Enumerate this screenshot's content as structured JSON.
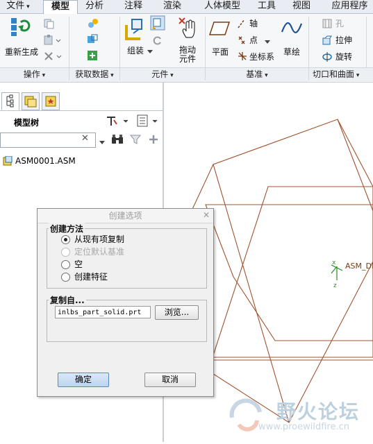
{
  "menu": {
    "tabs": [
      "文件",
      "模型",
      "分析",
      "注释",
      "渲染",
      "人体模型",
      "工具",
      "视图",
      "应用程序"
    ]
  },
  "ribbon": {
    "regenerate": "重新生成",
    "assemble": "组装",
    "drag_components": [
      "拖动",
      "元件"
    ],
    "plane": "平面",
    "axis": "轴",
    "point": "点",
    "csys": "坐标系",
    "sketch": "草绘",
    "hole": "孔",
    "extrude": "拉伸",
    "revolve": "旋转",
    "groups": [
      "操作",
      "获取数据",
      "元件",
      "基准",
      "切口和曲面"
    ]
  },
  "model_tree": {
    "title": "模型树",
    "search_value": "",
    "root_item": "ASM0001.ASM"
  },
  "graphics": {
    "csys_label": "ASM_DI",
    "axis_x": "x",
    "axis_z": "z",
    "csys_color": "#2a8a2a",
    "edge_color": "#a0522d"
  },
  "dialog": {
    "title": "创建选项",
    "method_legend": "创建方法",
    "options": [
      "从现有项复制",
      "定位默认基准",
      "空",
      "创建特征"
    ],
    "selected_option": "从现有项复制",
    "copy_from_legend": "复制自...",
    "copy_from_value": "inlbs_part_solid.prt",
    "browse_button": "浏览...",
    "ok_button": "确定",
    "cancel_button": "取消"
  },
  "watermark": {
    "name": "野火论坛",
    "url": "www.proewildfire.cn"
  }
}
